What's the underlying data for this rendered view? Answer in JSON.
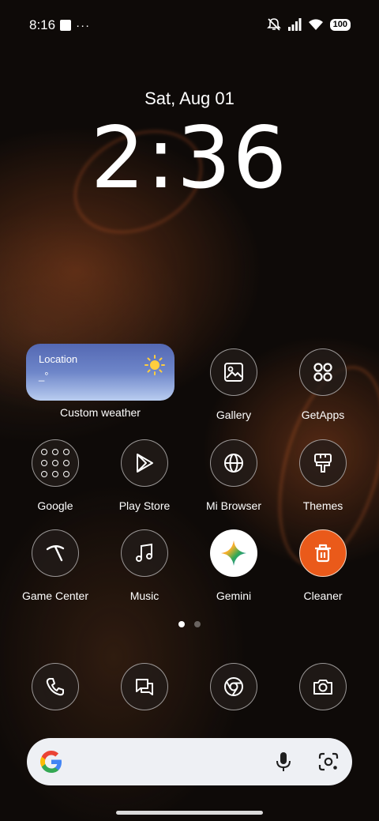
{
  "status_bar": {
    "time": "8:16",
    "more": "···",
    "battery": "100"
  },
  "lock_clock": {
    "date": "Sat, Aug 01",
    "time": "2:36"
  },
  "weather_widget": {
    "title": "Location",
    "temp": "_°",
    "label": "Custom weather"
  },
  "apps": [
    {
      "label": "Gallery",
      "icon": "gallery-icon"
    },
    {
      "label": "GetApps",
      "icon": "getapps-icon"
    },
    {
      "label": "Google",
      "icon": "google-folder-icon"
    },
    {
      "label": "Play Store",
      "icon": "play-store-icon"
    },
    {
      "label": "Mi Browser",
      "icon": "globe-icon"
    },
    {
      "label": "Themes",
      "icon": "paint-brush-icon"
    },
    {
      "label": "Game Center",
      "icon": "game-center-icon"
    },
    {
      "label": "Music",
      "icon": "music-note-icon"
    },
    {
      "label": "Gemini",
      "icon": "gemini-icon"
    },
    {
      "label": "Cleaner",
      "icon": "trash-icon"
    }
  ],
  "dock": [
    {
      "icon": "phone-icon"
    },
    {
      "icon": "messages-icon"
    },
    {
      "icon": "chrome-icon"
    },
    {
      "icon": "camera-icon"
    }
  ],
  "page_indicator": {
    "pages": 2,
    "active": 1
  },
  "search_bar": {
    "logo": "google-g-icon",
    "mic": "mic-icon",
    "lens": "google-lens-icon"
  },
  "colors": {
    "cleaner": "#ea5a1a",
    "weather_top": "#5468b3",
    "weather_bottom": "#b9cdf0",
    "search_bg": "#eef0f4"
  }
}
